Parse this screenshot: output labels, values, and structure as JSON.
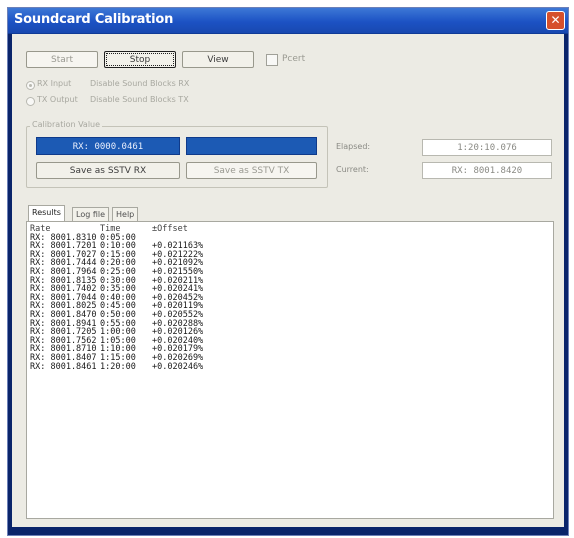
{
  "window": {
    "title": "Soundcard Calibration"
  },
  "toolbar": {
    "start_label": "Start",
    "stop_label": "Stop",
    "view_label": "View",
    "pcert_label": "Pcert"
  },
  "options": {
    "rx_input": "RX Input",
    "tx_output": "TX Output",
    "disable_rx_blocks": "Disable Sound Blocks RX",
    "disable_tx_blocks": "Disable Sound Blocks TX"
  },
  "calibration": {
    "group_label": "Calibration Value",
    "rx_value": "RX: 0000.0461",
    "tx_value": "",
    "save_rx_label": "Save as SSTV RX",
    "save_tx_label": "Save as SSTV TX"
  },
  "status": {
    "elapsed_label": "Elapsed:",
    "elapsed_value": "1:20:10.076",
    "current_label": "Current:",
    "current_value": "RX: 8001.8420"
  },
  "tabs": [
    "Results",
    "Log file",
    "Help"
  ],
  "results": {
    "headers": [
      "Rate",
      "Time",
      "±Offset"
    ],
    "rows": [
      [
        "RX: 8001.8310",
        "0:05:00",
        ""
      ],
      [
        "RX: 8001.7201",
        "0:10:00",
        "+0.021163%"
      ],
      [
        "RX: 8001.7027",
        "0:15:00",
        "+0.021222%"
      ],
      [
        "RX: 8001.7444",
        "0:20:00",
        "+0.021092%"
      ],
      [
        "RX: 8001.7964",
        "0:25:00",
        "+0.021550%"
      ],
      [
        "RX: 8001.8135",
        "0:30:00",
        "+0.020211%"
      ],
      [
        "RX: 8001.7402",
        "0:35:00",
        "+0.020241%"
      ],
      [
        "RX: 8001.7044",
        "0:40:00",
        "+0.020452%"
      ],
      [
        "RX: 8001.8025",
        "0:45:00",
        "+0.020119%"
      ],
      [
        "RX: 8001.8470",
        "0:50:00",
        "+0.020552%"
      ],
      [
        "RX: 8001.8941",
        "0:55:00",
        "+0.020288%"
      ],
      [
        "RX: 8001.7205",
        "1:00:00",
        "+0.020126%"
      ],
      [
        "RX: 8001.7562",
        "1:05:00",
        "+0.020240%"
      ],
      [
        "RX: 8001.8710",
        "1:10:00",
        "+0.020179%"
      ],
      [
        "RX: 8001.8407",
        "1:15:00",
        "+0.020269%"
      ],
      [
        "RX: 8001.8461",
        "1:20:00",
        "+0.020246%"
      ]
    ]
  }
}
